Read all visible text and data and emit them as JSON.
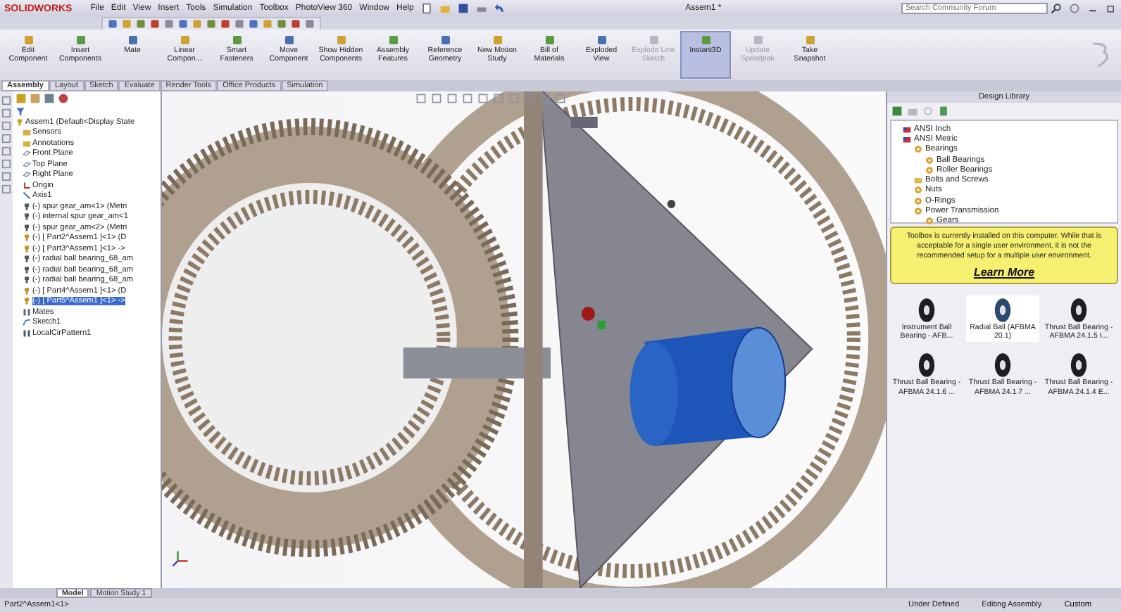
{
  "title_bar": {
    "logo": "SOLIDWORKS",
    "menus": [
      "File",
      "Edit",
      "View",
      "Insert",
      "Tools",
      "Simulation",
      "Toolbox",
      "PhotoView 360",
      "Window",
      "Help"
    ],
    "title": "Assem1 *",
    "search": {
      "placeholder": "Search Community Forum"
    }
  },
  "command_manager": {
    "buttons": [
      {
        "label": "Edit Component",
        "selected": false,
        "disabled": false
      },
      {
        "label": "Insert Components",
        "selected": false,
        "disabled": false
      },
      {
        "label": "Mate",
        "selected": false,
        "disabled": false
      },
      {
        "label": "Linear Compon...",
        "selected": false,
        "disabled": false
      },
      {
        "label": "Smart Fasteners",
        "selected": false,
        "disabled": false
      },
      {
        "label": "Move Component",
        "selected": false,
        "disabled": false
      },
      {
        "label": "Show Hidden Components",
        "selected": false,
        "disabled": false
      },
      {
        "label": "Assembly Features",
        "selected": false,
        "disabled": false
      },
      {
        "label": "Reference Geometry",
        "selected": false,
        "disabled": false
      },
      {
        "label": "New Motion Study",
        "selected": false,
        "disabled": false
      },
      {
        "label": "Bill of Materials",
        "selected": false,
        "disabled": false
      },
      {
        "label": "Exploded View",
        "selected": false,
        "disabled": false
      },
      {
        "label": "Explode Line Sketch",
        "selected": false,
        "disabled": true
      },
      {
        "label": "Instant3D",
        "selected": true,
        "disabled": false
      },
      {
        "label": "Update Speedpak",
        "selected": false,
        "disabled": true
      },
      {
        "label": "Take Snapshot",
        "selected": false,
        "disabled": false
      }
    ]
  },
  "tabs": [
    {
      "label": "Assembly",
      "selected": true
    },
    {
      "label": "Layout",
      "selected": false
    },
    {
      "label": "Sketch",
      "selected": false
    },
    {
      "label": "Evaluate",
      "selected": false
    },
    {
      "label": "Render Tools",
      "selected": false
    },
    {
      "label": "Office Products",
      "selected": false
    },
    {
      "label": "Simulation",
      "selected": false
    }
  ],
  "feature_tree": {
    "items": [
      {
        "label": "Assem1 (Default<Display State",
        "kind": "assembly",
        "selected": false,
        "children": [
          {
            "label": "Sensors",
            "kind": "folder",
            "selected": false
          },
          {
            "label": "Annotations",
            "kind": "folder",
            "selected": false
          },
          {
            "label": "Front Plane",
            "kind": "plane",
            "selected": false
          },
          {
            "label": "Top Plane",
            "kind": "plane",
            "selected": false
          },
          {
            "label": "Right Plane",
            "kind": "plane",
            "selected": false
          },
          {
            "label": "Origin",
            "kind": "origin",
            "selected": false
          },
          {
            "label": "Axis1",
            "kind": "axis",
            "selected": false
          },
          {
            "label": "(-) spur gear_am<1> (Metri",
            "kind": "part",
            "selected": false
          },
          {
            "label": "(-) internal spur gear_am<1",
            "kind": "part",
            "selected": false
          },
          {
            "label": "(-) spur gear_am<2> (Metri",
            "kind": "part",
            "selected": false
          },
          {
            "label": "(-) [ Part2^Assem1 ]<1> (D",
            "kind": "virtual",
            "selected": false
          },
          {
            "label": "(-) [ Part3^Assem1 ]<1> ->",
            "kind": "virtual",
            "selected": false
          },
          {
            "label": "(-) radial ball bearing_68_am",
            "kind": "part",
            "selected": false
          },
          {
            "label": "(-) radial ball bearing_68_am",
            "kind": "part",
            "selected": false
          },
          {
            "label": "(-) radial ball bearing_68_am",
            "kind": "part",
            "selected": false
          },
          {
            "label": "(-) [ Part4^Assem1 ]<1> (D",
            "kind": "virtual",
            "selected": false
          },
          {
            "label": "(-) [ Part5^Assem1 ]<1> ->",
            "kind": "virtual",
            "selected": true
          },
          {
            "label": "Mates",
            "kind": "mates",
            "selected": false
          },
          {
            "label": "Sketch1",
            "kind": "sketch",
            "selected": false
          },
          {
            "label": "LocalCirPattern1",
            "kind": "pattern",
            "selected": false
          }
        ]
      }
    ]
  },
  "design_library": {
    "title": "Design Library",
    "tree": [
      {
        "label": "ANSI Inch",
        "kind": "standard"
      },
      {
        "label": "ANSI Metric",
        "kind": "standard",
        "children": [
          {
            "label": "Bearings",
            "kind": "category",
            "children": [
              {
                "label": "Ball Bearings",
                "kind": "category"
              },
              {
                "label": "Roller Bearings",
                "kind": "category"
              }
            ]
          },
          {
            "label": "Bolts and Screws",
            "kind": "folder"
          },
          {
            "label": "Nuts",
            "kind": "category"
          },
          {
            "label": "O-Rings",
            "kind": "category"
          },
          {
            "label": "Power Transmission",
            "kind": "category",
            "children": [
              {
                "label": "Gears",
                "kind": "category"
              }
            ]
          }
        ]
      }
    ],
    "notice": "Toolbox is currently installed on this computer. While that is acceptable for a single user environment, it is not the recommended setup for a multiple user environment.",
    "notice_link": "Learn More",
    "items": [
      {
        "label": "Instrument Ball Bearing - AFB...",
        "selected": false
      },
      {
        "label": "Radial Ball (AFBMA 20.1)",
        "selected": true
      },
      {
        "label": "Thrust Ball Bearing - AFBMA 24.1.5 I...",
        "selected": false
      },
      {
        "label": "Thrust Ball Bearing - AFBMA 24.1.6 ...",
        "selected": false
      },
      {
        "label": "Thrust Ball Bearing - AFBMA 24.1.7 ...",
        "selected": false
      },
      {
        "label": "Thrust Ball Bearing - AFBMA 24.1.4 E...",
        "selected": false
      }
    ]
  },
  "bottom_tabs": [
    {
      "label": "Model",
      "selected": true
    },
    {
      "label": "Motion Study 1",
      "selected": false
    }
  ],
  "status_bar": {
    "selection": "Part2^Assem1<1>",
    "state": "Under Defined",
    "mode": "Editing Assembly",
    "units": "Custom"
  }
}
